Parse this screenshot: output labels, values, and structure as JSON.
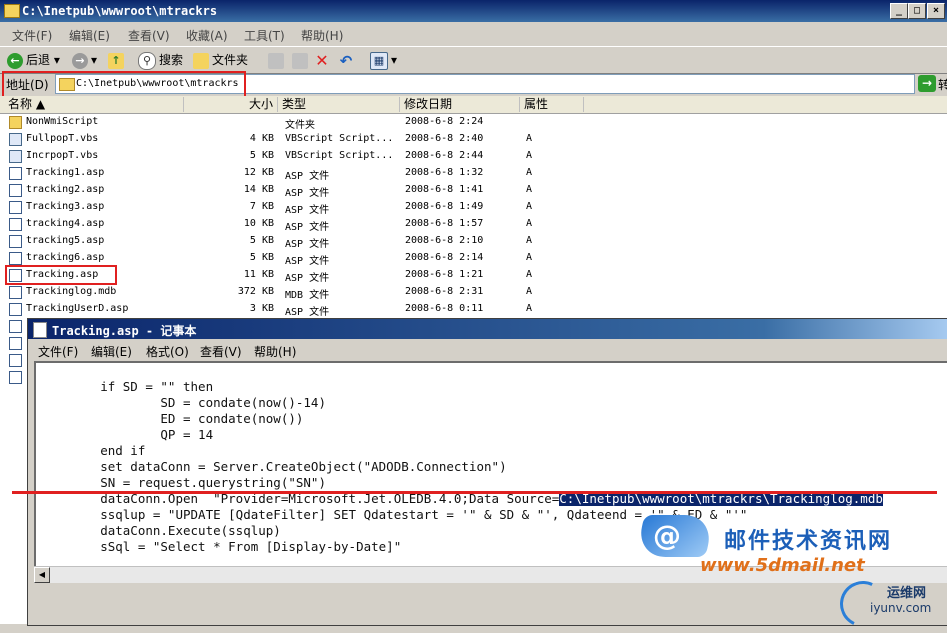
{
  "explorer": {
    "title": "C:\\Inetpub\\wwwroot\\mtrackrs",
    "menu": [
      "文件(F)",
      "编辑(E)",
      "查看(V)",
      "收藏(A)",
      "工具(T)",
      "帮助(H)"
    ],
    "toolbar": {
      "back_label": "后退",
      "search_label": "搜索",
      "folders_label": "文件夹"
    },
    "address": {
      "label": "地址(D)",
      "value": "C:\\Inetpub\\wwwroot\\mtrackrs",
      "go_label": "转"
    },
    "columns": {
      "name": "名称",
      "size": "大小",
      "type": "类型",
      "modified": "修改日期",
      "attributes": "属性"
    },
    "files": [
      {
        "name": "NonWmiScript",
        "size": "",
        "type": "文件夹",
        "modified": "2008-6-8 2:24",
        "attr": "",
        "icon": "folder"
      },
      {
        "name": "FullpopT.vbs",
        "size": "4 KB",
        "type": "VBScript Script...",
        "modified": "2008-6-8 2:40",
        "attr": "A",
        "icon": "vbs"
      },
      {
        "name": "IncrpopT.vbs",
        "size": "5 KB",
        "type": "VBScript Script...",
        "modified": "2008-6-8 2:44",
        "attr": "A",
        "icon": "vbs"
      },
      {
        "name": "Tracking1.asp",
        "size": "12 KB",
        "type": "ASP 文件",
        "modified": "2008-6-8 1:32",
        "attr": "A",
        "icon": "asp"
      },
      {
        "name": "tracking2.asp",
        "size": "14 KB",
        "type": "ASP 文件",
        "modified": "2008-6-8 1:41",
        "attr": "A",
        "icon": "asp"
      },
      {
        "name": "Tracking3.asp",
        "size": "7 KB",
        "type": "ASP 文件",
        "modified": "2008-6-8 1:49",
        "attr": "A",
        "icon": "asp"
      },
      {
        "name": "tracking4.asp",
        "size": "10 KB",
        "type": "ASP 文件",
        "modified": "2008-6-8 1:57",
        "attr": "A",
        "icon": "asp"
      },
      {
        "name": "tracking5.asp",
        "size": "5 KB",
        "type": "ASP 文件",
        "modified": "2008-6-8 2:10",
        "attr": "A",
        "icon": "asp"
      },
      {
        "name": "tracking6.asp",
        "size": "5 KB",
        "type": "ASP 文件",
        "modified": "2008-6-8 2:14",
        "attr": "A",
        "icon": "asp"
      },
      {
        "name": "Tracking.asp",
        "size": "11 KB",
        "type": "ASP 文件",
        "modified": "2008-6-8 1:21",
        "attr": "A",
        "icon": "asp"
      },
      {
        "name": "Trackinglog.mdb",
        "size": "372 KB",
        "type": "MDB 文件",
        "modified": "2008-6-8 2:31",
        "attr": "A",
        "icon": "mdb"
      },
      {
        "name": "TrackingUserD.asp",
        "size": "3 KB",
        "type": "ASP 文件",
        "modified": "2008-6-8 0:11",
        "attr": "A",
        "icon": "asp"
      }
    ]
  },
  "notepad": {
    "title": "Tracking.asp - 记事本",
    "menu": [
      "文件(F)",
      "编辑(E)",
      "格式(O)",
      "查看(V)",
      "帮助(H)"
    ],
    "lines": [
      "        if SD = \"\" then",
      "                SD = condate(now()-14)",
      "                ED = condate(now())",
      "                QP = 14",
      "        end if",
      "        set dataConn = Server.CreateObject(\"ADODB.Connection\")",
      "        SN = request.querystring(\"SN\")",
      "        dataConn.Open  \"Provider=Microsoft.Jet.OLEDB.4.0;Data Source=",
      "        ssqlup = \"UPDATE [QdateFilter] SET Qdatestart = '\" & SD & \"', Qdateend = '\" & ED & \"'\"",
      "        dataConn.Execute(ssqlup)",
      "        sSql = \"Select * From [Display-by-Date]\""
    ],
    "highlighted_text": "C:\\Inetpub\\wwwroot\\mtrackrs\\Trackinglog.mdb"
  },
  "watermarks": {
    "site1_name": "邮件技术资讯网",
    "site1_url": "www.5dmail.net",
    "site2_name": "运维网",
    "site2_url": "iyunv.com"
  }
}
